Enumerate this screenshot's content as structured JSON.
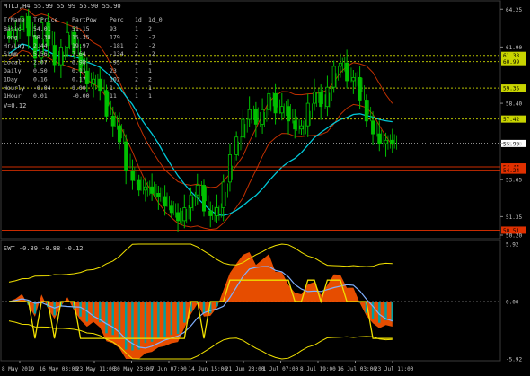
{
  "header": {
    "title": "MTLJ,H4  55.99 55.99 55.90 55.90",
    "lower_title": "SWT -0.89 -0.88 -0.12"
  },
  "stats_table": {
    "columns": [
      "TrName",
      "TrPrice",
      "PartPow",
      "Perc",
      "1d",
      "1d_0"
    ],
    "rows": [
      [
        "Basic",
        "54.01",
        "51.15",
        "93",
        "1",
        "2"
      ],
      [
        "Long",
        "58.38",
        "15.35",
        "179",
        "2",
        "-2"
      ],
      [
        "Hr/Lng",
        "2.44",
        "19.97",
        "-181",
        "2",
        "-2"
      ],
      [
        "Simm",
        "5.56",
        "7.64",
        "-134",
        "2",
        "-2"
      ],
      [
        "Local",
        "2.07",
        "6.98",
        "-95",
        "2",
        "1"
      ],
      [
        "Daily",
        "0.50",
        "0.11",
        "23",
        "1",
        "1"
      ],
      [
        "1Day",
        "0.16",
        "0.17",
        "102",
        "2",
        "2"
      ],
      [
        "Hourly",
        "-0.04",
        "0.00",
        "1",
        "1",
        "1"
      ],
      [
        "1Hour",
        "0.01",
        "-0.00",
        "11",
        "1",
        "1"
      ]
    ],
    "footer": "V=0.12"
  },
  "price_axis": {
    "ticks": [
      "64.25",
      "61.90",
      "58.40",
      "55.90",
      "53.65",
      "51.35",
      "50.20"
    ],
    "tick_values": [
      64.25,
      61.9,
      58.4,
      55.9,
      53.65,
      51.35,
      50.2
    ],
    "tags": [
      {
        "label": "61.38",
        "value": 61.38,
        "color": "#c8d400"
      },
      {
        "label": "60.99",
        "value": 60.99,
        "color": "#c8d400"
      },
      {
        "label": "59.35",
        "value": 59.35,
        "color": "#c8d400"
      },
      {
        "label": "57.42",
        "value": 57.42,
        "color": "#c8d400"
      },
      {
        "label": "55.90",
        "value": 55.9,
        "color": "#ffffff"
      },
      {
        "label": "54.44",
        "value": 54.44,
        "color": "#e03000"
      },
      {
        "label": "54.24",
        "value": 54.24,
        "color": "#e03000"
      },
      {
        "label": "50.51",
        "value": 50.51,
        "color": "#e03000"
      }
    ]
  },
  "lower_axis": {
    "ticks": [
      "5.92",
      "0.00",
      "-5.92"
    ],
    "tick_values": [
      5.92,
      0,
      -5.92
    ]
  },
  "time_axis": {
    "labels": [
      "8 May 2019",
      "16 May 03:00",
      "23 May 11:00",
      "30 May 23:00",
      "7 Jun 07:00",
      "14 Jun 15:00",
      "21 Jun 23:00",
      "1 Jul 07:00",
      "8 Jul 19:00",
      "16 Jul 03:00",
      "23 Jul 11:00"
    ]
  },
  "colors": {
    "background": "#000000",
    "bull": "#00c000",
    "bear": "#00c000",
    "ma_red": "#c03000",
    "ma_cyan": "#00c8d8",
    "level_yellow": "#c8d400",
    "swt_orange": "#ff5500",
    "swt_teal": "#00a0a0",
    "swt_blue": "#80b0ff",
    "swt_yellow": "#f0e000"
  },
  "chart_data": {
    "type": "candlestick",
    "price_close_series": [
      62.5,
      63.0,
      63.8,
      62.6,
      61.2,
      63.4,
      62.0,
      60.8,
      61.9,
      62.8,
      61.5,
      60.4,
      59.6,
      59.9,
      59.2,
      57.6,
      57.0,
      56.0,
      54.2,
      53.6,
      53.0,
      53.2,
      52.8,
      52.6,
      52.0,
      51.6,
      51.1,
      51.9,
      52.7,
      53.3,
      51.7,
      51.4,
      51.9,
      53.5,
      55.2,
      56.3,
      57.4,
      58.0,
      57.1,
      58.0,
      59.0,
      57.8,
      58.2,
      57.3,
      56.8,
      57.0,
      58.4,
      59.1,
      58.2,
      59.4,
      60.7,
      60.9,
      59.8,
      60.0,
      58.6,
      57.3,
      56.5,
      55.9,
      56.1,
      55.9
    ],
    "levels": [
      61.38,
      60.99,
      59.35,
      57.42,
      55.9,
      54.44,
      54.24,
      50.51
    ],
    "price_range": [
      50.2,
      64.6
    ],
    "oscillator_range": [
      -5.92,
      5.92
    ]
  }
}
